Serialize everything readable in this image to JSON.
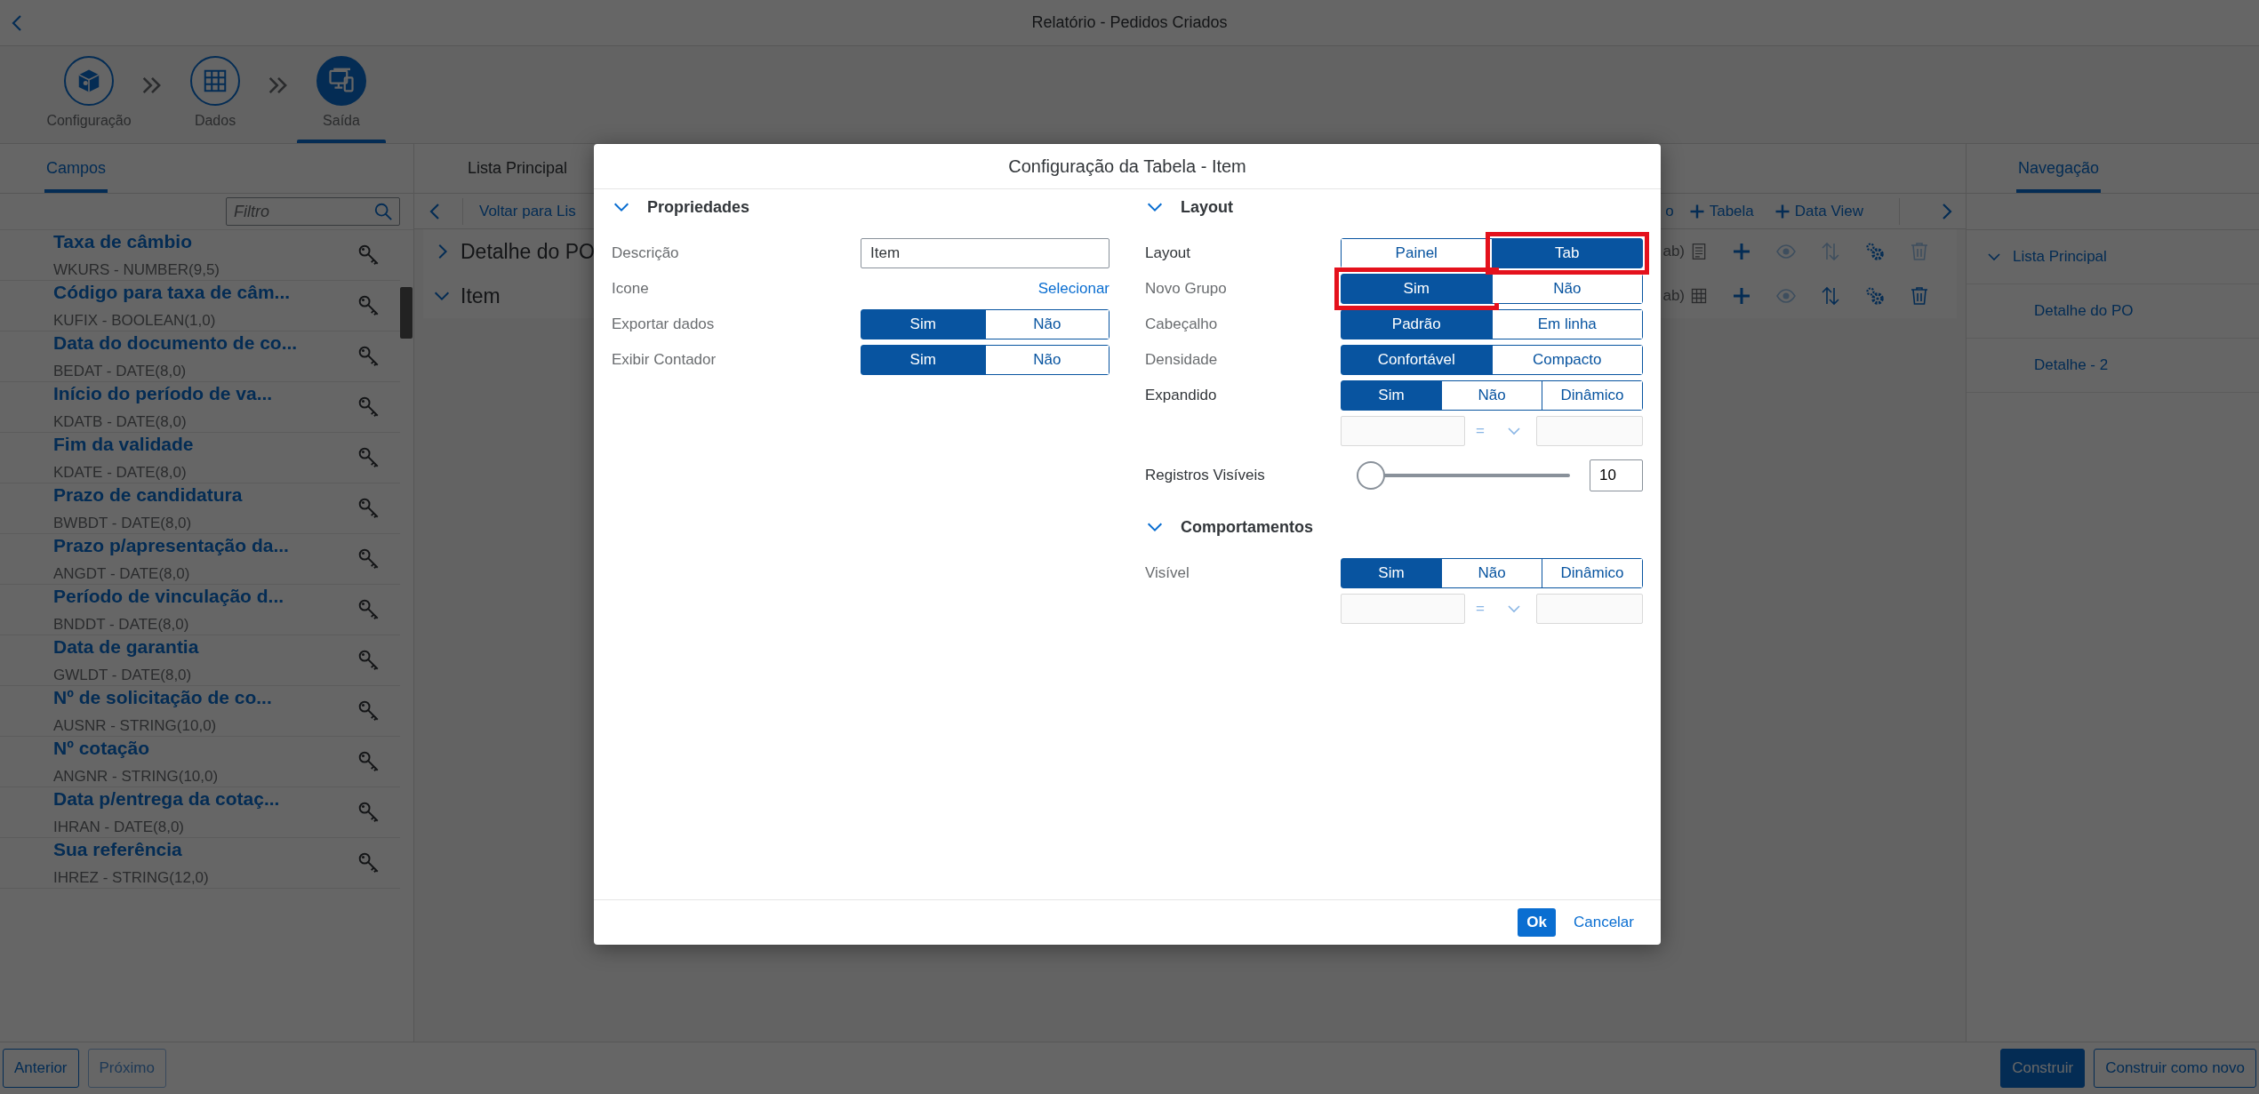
{
  "header": {
    "title": "Relatório - Pedidos Criados"
  },
  "wizard": {
    "steps": [
      {
        "label": "Configuração",
        "selected": false
      },
      {
        "label": "Dados",
        "selected": false
      },
      {
        "label": "Saída",
        "selected": true
      }
    ]
  },
  "fields_panel": {
    "tabs": [
      {
        "label": "Campos",
        "selected": true
      }
    ],
    "filter": {
      "placeholder": "Filtro"
    },
    "fields": [
      {
        "name": "Taxa de câmbio",
        "type": "WKURS - NUMBER(9,5)"
      },
      {
        "name": "Código para taxa de câm...",
        "type": "KUFIX - BOOLEAN(1,0)"
      },
      {
        "name": "Data do documento de co...",
        "type": "BEDAT - DATE(8,0)"
      },
      {
        "name": "Início do período de va...",
        "type": "KDATB - DATE(8,0)"
      },
      {
        "name": "Fim da validade",
        "type": "KDATE - DATE(8,0)"
      },
      {
        "name": "Prazo de candidatura",
        "type": "BWBDT - DATE(8,0)"
      },
      {
        "name": "Prazo p/apresentação da...",
        "type": "ANGDT - DATE(8,0)"
      },
      {
        "name": "Período de vinculação d...",
        "type": "BNDDT - DATE(8,0)"
      },
      {
        "name": "Data de garantia",
        "type": "GWLDT - DATE(8,0)"
      },
      {
        "name": "Nº de solicitação de co...",
        "type": "AUSNR - STRING(10,0)"
      },
      {
        "name": "Nº cotação",
        "type": "ANGNR - STRING(10,0)"
      },
      {
        "name": "Data p/entrega da cotaç...",
        "type": "IHRAN - DATE(8,0)"
      },
      {
        "name": "Sua referência",
        "type": "IHREZ - STRING(12,0)"
      }
    ]
  },
  "main_panel": {
    "tabs": [
      {
        "label": "Lista Principal",
        "selected": false
      }
    ],
    "toolbar": {
      "back_link": "Voltar para Lis",
      "cut_text": "o",
      "actions": [
        "Tabela",
        "Data View"
      ]
    },
    "sections": [
      {
        "label": "Detalhe do PO",
        "expanded": false,
        "suffix": "ab)",
        "actions": [
          {
            "kind": "add",
            "disabled": false
          },
          {
            "kind": "view",
            "disabled": true
          },
          {
            "kind": "sort",
            "disabled": true
          },
          {
            "kind": "settings",
            "disabled": false
          },
          {
            "kind": "delete",
            "disabled": true
          }
        ]
      },
      {
        "label": "Item",
        "expanded": true,
        "suffix": "ab)",
        "actions": [
          {
            "kind": "add",
            "disabled": false
          },
          {
            "kind": "view",
            "disabled": true
          },
          {
            "kind": "sort",
            "disabled": false
          },
          {
            "kind": "settings",
            "disabled": false
          },
          {
            "kind": "delete",
            "disabled": false
          }
        ]
      }
    ]
  },
  "navigation": {
    "tabs": [
      {
        "label": "Navegação",
        "selected": true
      }
    ],
    "tree": [
      {
        "label": "Lista Principal",
        "expanded": true,
        "children": [
          {
            "label": "Detalhe do PO"
          },
          {
            "label": "Detalhe - 2"
          }
        ]
      }
    ]
  },
  "footer": {
    "left": [
      {
        "label": "Anterior",
        "kind": "default",
        "disabled": false
      },
      {
        "label": "Próximo",
        "kind": "default",
        "disabled": true
      }
    ],
    "right": [
      {
        "label": "Construir",
        "kind": "emphasized",
        "disabled": false
      },
      {
        "label": "Construir como novo",
        "kind": "default",
        "disabled": false
      }
    ]
  },
  "dialog": {
    "title": "Configuração da Tabela - Item",
    "columns": [
      {
        "sections": [
          {
            "title": "Propriedades",
            "expanded": true,
            "rows": [
              {
                "kind": "input",
                "label": "Descrição",
                "emphasized": false,
                "value": "Item"
              },
              {
                "kind": "link",
                "label": "Icone",
                "emphasized": false,
                "link": "Selecionar"
              },
              {
                "kind": "segmented",
                "label": "Exportar dados",
                "emphasized": false,
                "options": [
                  {
                    "label": "Sim",
                    "selected": true,
                    "highlighted": false
                  },
                  {
                    "label": "Não",
                    "selected": false,
                    "highlighted": false
                  }
                ]
              },
              {
                "kind": "segmented",
                "label": "Exibir Contador",
                "emphasized": false,
                "options": [
                  {
                    "label": "Sim",
                    "selected": true,
                    "highlighted": false
                  },
                  {
                    "label": "Não",
                    "selected": false,
                    "highlighted": false
                  }
                ]
              }
            ]
          }
        ]
      },
      {
        "sections": [
          {
            "title": "Layout",
            "expanded": true,
            "rows": [
              {
                "kind": "segmented",
                "label": "Layout",
                "emphasized": true,
                "options": [
                  {
                    "label": "Painel",
                    "selected": false,
                    "highlighted": false
                  },
                  {
                    "label": "Tab",
                    "selected": true,
                    "highlighted": true
                  }
                ]
              },
              {
                "kind": "segmented",
                "label": "Novo Grupo",
                "emphasized": false,
                "options": [
                  {
                    "label": "Sim",
                    "selected": true,
                    "highlighted": true
                  },
                  {
                    "label": "Não",
                    "selected": false,
                    "highlighted": false
                  }
                ]
              },
              {
                "kind": "segmented",
                "label": "Cabeçalho",
                "emphasized": false,
                "options": [
                  {
                    "label": "Padrão",
                    "selected": true,
                    "highlighted": false
                  },
                  {
                    "label": "Em linha",
                    "selected": false,
                    "highlighted": false
                  }
                ]
              },
              {
                "kind": "segmented",
                "label": "Densidade",
                "emphasized": false,
                "options": [
                  {
                    "label": "Confortável",
                    "selected": true,
                    "highlighted": false
                  },
                  {
                    "label": "Compacto",
                    "selected": false,
                    "highlighted": false
                  }
                ]
              },
              {
                "kind": "segmented",
                "label": "Expandido",
                "emphasized": true,
                "options": [
                  {
                    "label": "Sim",
                    "selected": true,
                    "highlighted": false
                  },
                  {
                    "label": "Não",
                    "selected": false,
                    "highlighted": false
                  },
                  {
                    "label": "Dinâmico",
                    "selected": false,
                    "highlighted": false
                  }
                ]
              },
              {
                "kind": "condition",
                "operator": "=",
                "disabled": true
              },
              {
                "kind": "slider",
                "label": "Registros Visíveis",
                "emphasized": true,
                "level": 0.05,
                "value": "10"
              }
            ]
          },
          {
            "title": "Comportamentos",
            "expanded": true,
            "rows": [
              {
                "kind": "segmented",
                "label": "Visível",
                "emphasized": false,
                "options": [
                  {
                    "label": "Sim",
                    "selected": true,
                    "highlighted": false
                  },
                  {
                    "label": "Não",
                    "selected": false,
                    "highlighted": false
                  },
                  {
                    "label": "Dinâmico",
                    "selected": false,
                    "highlighted": false
                  }
                ]
              },
              {
                "kind": "condition",
                "operator": "=",
                "disabled": true
              }
            ]
          }
        ]
      }
    ],
    "buttons": [
      {
        "label": "Ok",
        "kind": "emphasized"
      },
      {
        "label": "Cancelar",
        "kind": "transparent"
      }
    ]
  }
}
